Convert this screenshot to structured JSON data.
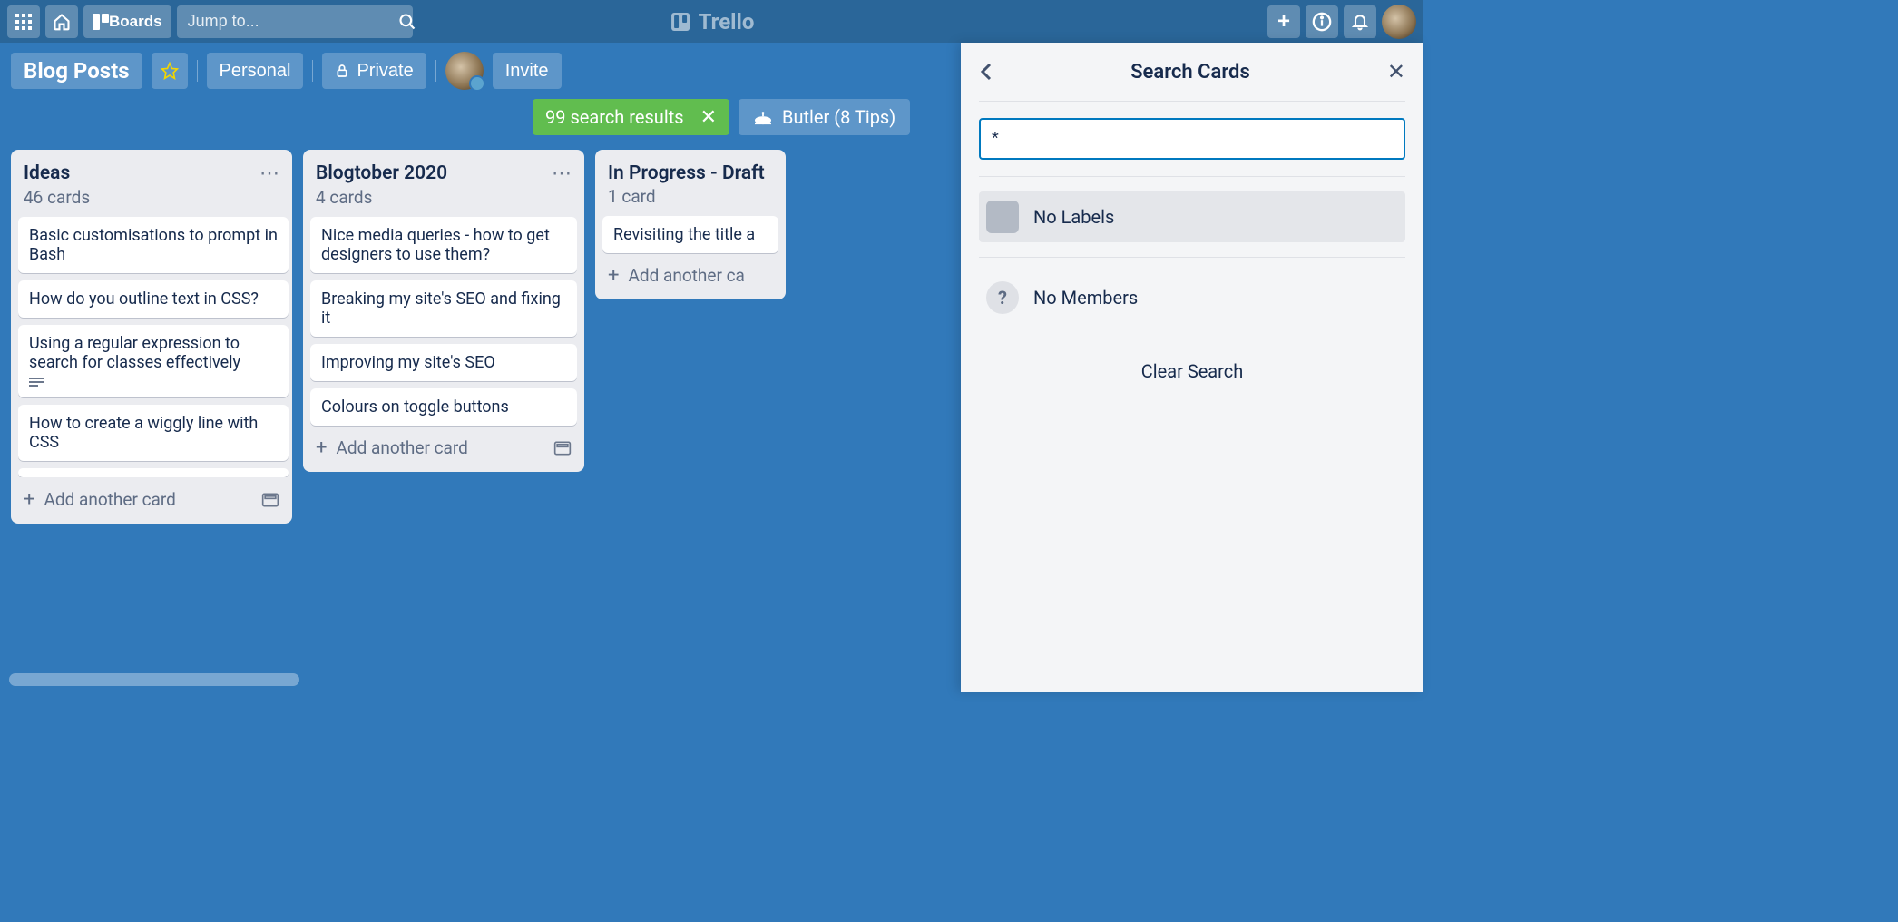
{
  "topbar": {
    "boards_label": "Boards",
    "search_placeholder": "Jump to...",
    "brand": "Trello"
  },
  "board_header": {
    "title": "Blog Posts",
    "workspace": "Personal",
    "visibility": "Private",
    "invite_label": "Invite"
  },
  "filter_bar": {
    "results_text": "99 search results",
    "butler_text": "Butler (8 Tips)"
  },
  "lists": [
    {
      "title": "Ideas",
      "count": "46 cards",
      "cards": [
        {
          "text": "Basic customisations to prompt in Bash",
          "has_desc": false
        },
        {
          "text": "How do you outline text in CSS?",
          "has_desc": false
        },
        {
          "text": "Using a regular expression to search for classes effectively",
          "has_desc": true
        },
        {
          "text": "How to create a wiggly line with CSS",
          "has_desc": false
        }
      ],
      "add_label": "Add another card",
      "scrollable": true
    },
    {
      "title": "Blogtober 2020",
      "count": "4 cards",
      "cards": [
        {
          "text": "Nice media queries - how to get designers to use them?",
          "has_desc": false
        },
        {
          "text": "Breaking my site's SEO and fixing it",
          "has_desc": false
        },
        {
          "text": "Improving my site's SEO",
          "has_desc": false
        },
        {
          "text": "Colours on toggle buttons",
          "has_desc": false
        }
      ],
      "add_label": "Add another card",
      "scrollable": false
    },
    {
      "title": "In Progress - Draft",
      "count": "1 card",
      "cards": [
        {
          "text": "Revisiting the title a",
          "has_desc": false
        }
      ],
      "add_label": "Add another ca",
      "scrollable": false,
      "truncated": true
    }
  ],
  "panel": {
    "title": "Search Cards",
    "search_value": "*",
    "no_labels": "No Labels",
    "no_members": "No Members",
    "member_chip": "?",
    "clear": "Clear Search"
  }
}
